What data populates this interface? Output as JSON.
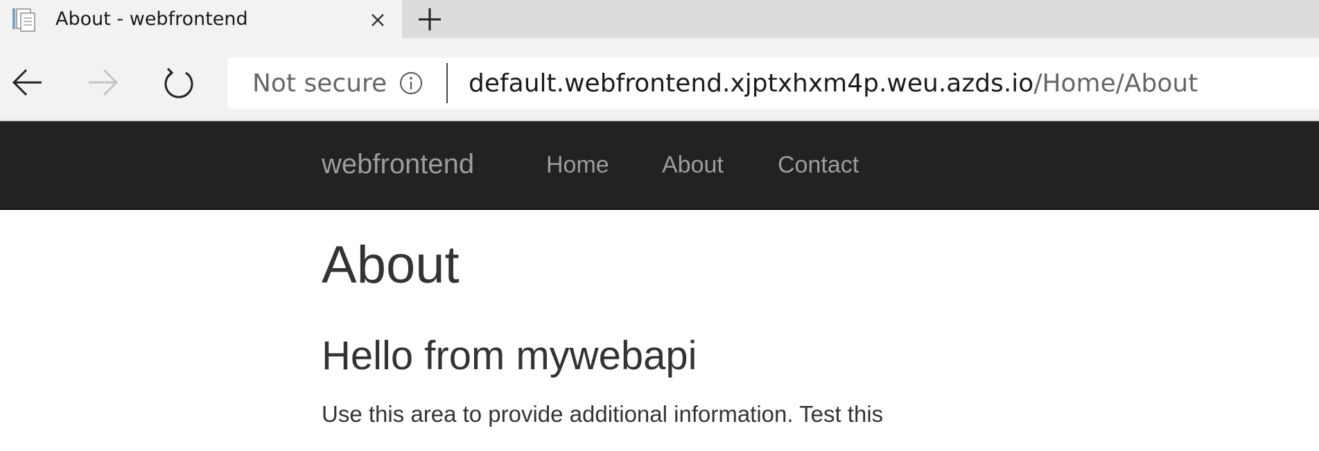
{
  "browser": {
    "tab": {
      "title": "About - webfrontend"
    },
    "address_bar": {
      "security_label": "Not secure",
      "url_host": "default.webfrontend.xjptxhxm4p.weu.azds.io",
      "url_path": "/Home/About"
    }
  },
  "site": {
    "navbar": {
      "brand": "webfrontend",
      "links": [
        "Home",
        "About",
        "Contact"
      ]
    },
    "main": {
      "title": "About",
      "message": "Hello from mywebapi",
      "body": "Use this area to provide additional information. Test this"
    }
  },
  "colors": {
    "navbar_bg": "#222222",
    "nav_text": "#9d9d9d",
    "body_text": "#333333"
  }
}
